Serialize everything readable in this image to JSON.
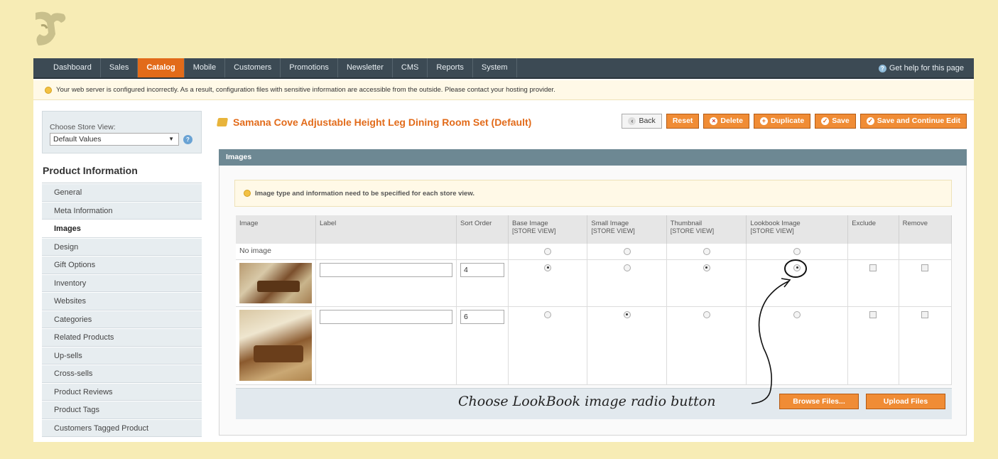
{
  "nav": {
    "items": [
      "Dashboard",
      "Sales",
      "Catalog",
      "Mobile",
      "Customers",
      "Promotions",
      "Newsletter",
      "CMS",
      "Reports",
      "System"
    ],
    "active_index": 2,
    "help": "Get help for this page"
  },
  "notice": "Your web server is configured incorrectly. As a result, configuration files with sensitive information are accessible from the outside. Please contact your hosting provider.",
  "sidebar": {
    "store_label": "Choose Store View:",
    "store_value": "Default Values",
    "section_title": "Product Information",
    "tabs": [
      "General",
      "Meta Information",
      "Images",
      "Design",
      "Gift Options",
      "Inventory",
      "Websites",
      "Categories",
      "Related Products",
      "Up-sells",
      "Cross-sells",
      "Product Reviews",
      "Product Tags",
      "Customers Tagged Product"
    ],
    "active_tab": "Images"
  },
  "header": {
    "title": "Samana Cove Adjustable Height Leg Dining Room Set (Default)",
    "buttons": [
      "Back",
      "Reset",
      "Delete",
      "Duplicate",
      "Save",
      "Save and Continue Edit"
    ]
  },
  "images": {
    "section_title": "Images",
    "hint": "Image type and information need to be specified for each store view.",
    "columns": {
      "image": "Image",
      "label": "Label",
      "sort": "Sort Order",
      "base": "Base Image",
      "small": "Small Image",
      "thumb": "Thumbnail",
      "lookbook": "Lookbook Image",
      "store_view": "[STORE VIEW]",
      "exclude": "Exclude",
      "remove": "Remove"
    },
    "no_image": "No image",
    "rows": [
      {
        "sort": "4",
        "base": true,
        "small": false,
        "thumb": true,
        "lookbook": true
      },
      {
        "sort": "6",
        "base": false,
        "small": true,
        "thumb": false,
        "lookbook": false
      }
    ],
    "browse": "Browse Files...",
    "upload": "Upload Files"
  },
  "annotation": "Choose LookBook image radio button"
}
